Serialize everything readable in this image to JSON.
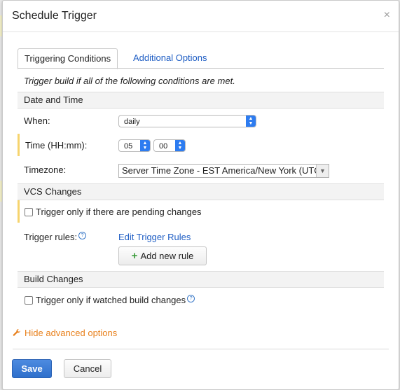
{
  "dialog": {
    "title": "Schedule Trigger",
    "close_glyph": "×"
  },
  "tabs": [
    {
      "label": "Triggering Conditions",
      "active": true
    },
    {
      "label": "Additional Options",
      "active": false
    }
  ],
  "intro": "Trigger build if all of the following conditions are met.",
  "date_time": {
    "header": "Date and Time",
    "when_label": "When:",
    "when_value": "daily",
    "time_label": "Time (HH:mm):",
    "hour_value": "05",
    "minute_value": "00",
    "timezone_label": "Timezone:",
    "timezone_value": "Server Time Zone - EST America/New York (UTC"
  },
  "vcs": {
    "header": "VCS Changes",
    "pending_label": "Trigger only if there are pending changes",
    "pending_checked": false,
    "rules_label": "Trigger rules:",
    "edit_rules_link": "Edit Trigger Rules",
    "add_rule_label": "Add new rule"
  },
  "build_changes": {
    "header": "Build Changes",
    "watched_label": "Trigger only if watched build changes",
    "watched_checked": false
  },
  "advanced_link": "Hide advanced options",
  "footer": {
    "save_label": "Save",
    "cancel_label": "Cancel"
  },
  "colors": {
    "primary": "#2e6fcb",
    "link": "#1f5ec4",
    "advanced": "#e8801c",
    "marker": "#f6d46d",
    "section_bg": "#f3f3f3"
  },
  "icons": {
    "help": "question-circle-icon",
    "wrench": "wrench-icon",
    "plus": "plus-icon",
    "stepper": "up-down-stepper-icon"
  }
}
